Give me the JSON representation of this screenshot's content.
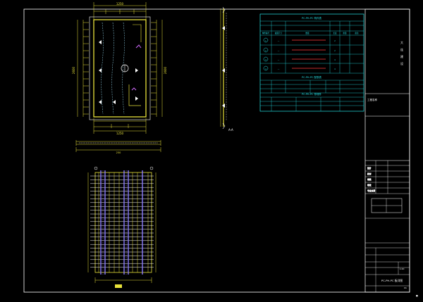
{
  "plan": {
    "dims": {
      "top": "1250",
      "bottom": "1250",
      "left": "2600",
      "right": "2600",
      "plate_thk": "250"
    }
  },
  "section": {
    "label": "A-A"
  },
  "table": {
    "title": "PC-PH-PC 构件表",
    "header": [
      "构件编号",
      "截面尺寸",
      "数量",
      "长度",
      "重量",
      "备注"
    ],
    "rows": [
      {
        "id": "1",
        "note": "—",
        "n": "2"
      },
      {
        "id": "2",
        "note": "—",
        "n": "2"
      },
      {
        "id": "3",
        "note": "—",
        "n": "4"
      },
      {
        "id": "4",
        "note": "—",
        "n": "4"
      }
    ],
    "sub_title": "PC-PH-PC 配筋表",
    "sub_title2": "PC-PH-PC 预埋件"
  },
  "titleblock": {
    "chars": [
      "大",
      "连",
      "建",
      "设"
    ],
    "project_label": "工程名称",
    "drawing_label": "PC-PH-PC 板详图",
    "rows": [
      "设计",
      "校对",
      "审核",
      "审定",
      "专业负责"
    ],
    "scale": "1:20",
    "sheet": "01"
  }
}
